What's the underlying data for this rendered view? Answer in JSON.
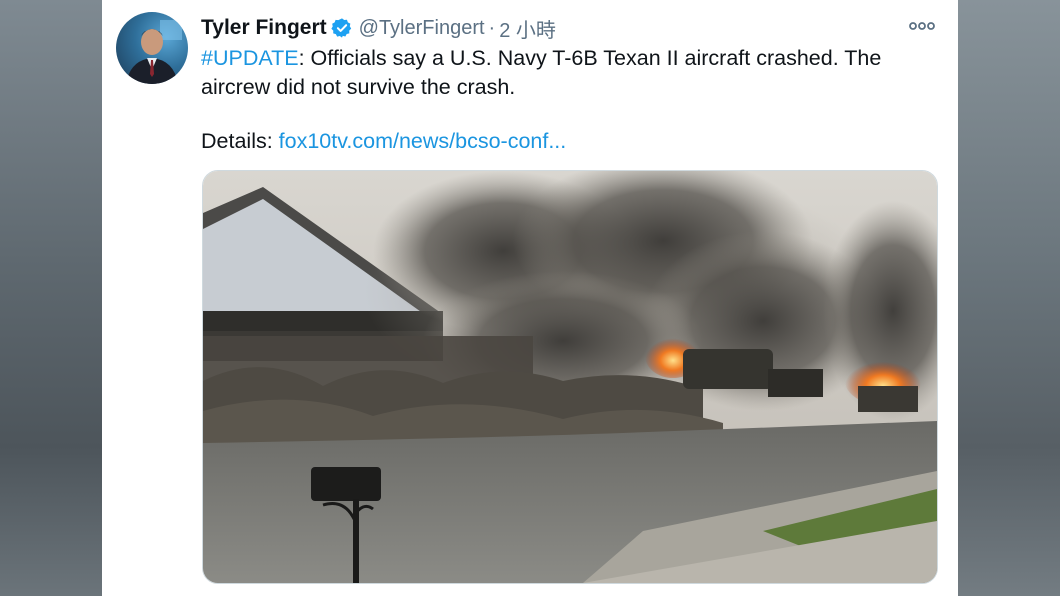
{
  "tweet": {
    "author": {
      "name": "Tyler Fingert",
      "handle": "@TylerFingert",
      "verified": true
    },
    "separator": "·",
    "timestamp": "2 小時",
    "more_icon": "more-dots-icon",
    "text": {
      "hashtag": "#UPDATE",
      "line1": ": Officials say a U.S. Navy T-6B Texan II aircraft crashed. The",
      "line2": "aircrew did not survive the crash.",
      "details_label": "Details: ",
      "link": "fox10tv.com/news/bcso-conf..."
    },
    "media": {
      "type": "photo"
    }
  },
  "colors": {
    "link": "#1b95e0",
    "verified": "#1da1f2",
    "secondary_text": "#5b7083",
    "primary_text": "#0f1419"
  }
}
